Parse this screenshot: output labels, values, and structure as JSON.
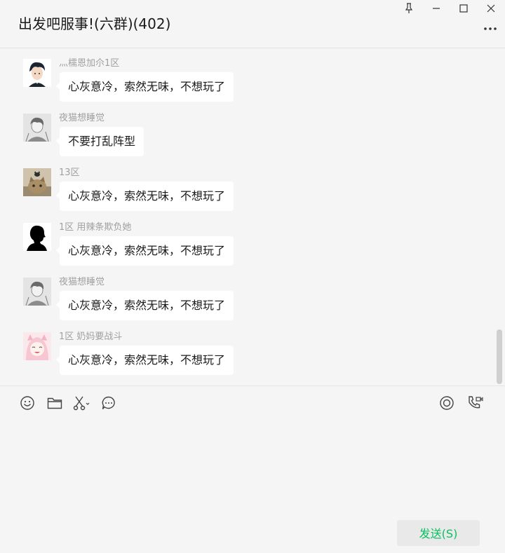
{
  "window": {
    "title": "出发吧服事!(六群)(402)",
    "controls": [
      "pin-icon",
      "minimize-icon",
      "maximize-icon",
      "close-icon"
    ],
    "more_icon": "more-icon"
  },
  "messages": [
    {
      "sender": "灬檽恩加尒1区",
      "text": "心灰意冷，索然无味，不想玩了",
      "avatar": "avatar-anime-boy"
    },
    {
      "sender": "夜猫想睡觉",
      "text": "不要打乱阵型",
      "avatar": "avatar-sketch-boy"
    },
    {
      "sender": "13区",
      "text": "心灰意冷，索然无味，不想玩了",
      "avatar": "avatar-cats"
    },
    {
      "sender": "1区 用辣条欺负她",
      "text": "心灰意冷，索然无味，不想玩了",
      "avatar": "avatar-silhouette"
    },
    {
      "sender": "夜猫想睡觉",
      "text": "心灰意冷，索然无味，不想玩了",
      "avatar": "avatar-sketch-boy"
    },
    {
      "sender": "1区 奶妈要战斗",
      "text": "心灰意冷，索然无味，不想玩了",
      "avatar": "avatar-anime-girl"
    }
  ],
  "toolbar": {
    "left": [
      "emoji-icon",
      "folder-icon",
      "scissors-icon",
      "chat-history-icon"
    ],
    "right": [
      "live-icon",
      "call-icon"
    ]
  },
  "input": {
    "value": ""
  },
  "send_button": {
    "label": "发送(S)"
  },
  "colors": {
    "send_text": "#07c160",
    "bubble": "#ffffff",
    "background": "#f5f5f5"
  }
}
